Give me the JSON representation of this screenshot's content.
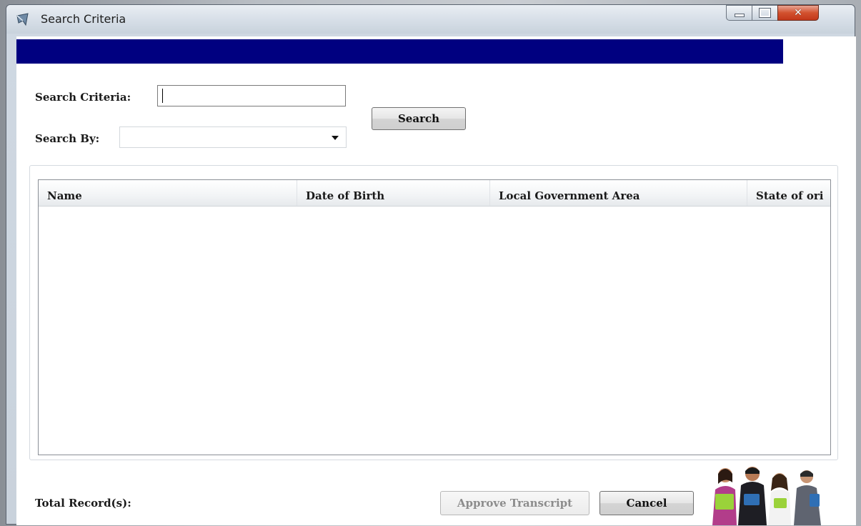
{
  "window": {
    "title": "Search Criteria"
  },
  "form": {
    "criteria_label": "Search Criteria:",
    "criteria_value": "",
    "search_by_label": "Search By:",
    "search_by_value": "",
    "search_button": "Search"
  },
  "grid": {
    "columns": [
      "Name",
      "Date of Birth",
      "Local Government Area",
      "State of ori"
    ]
  },
  "footer": {
    "total_label": "Total Record(s):",
    "approve_button": "Approve Transcript",
    "cancel_button": "Cancel"
  },
  "colors": {
    "banner": "#000080"
  }
}
